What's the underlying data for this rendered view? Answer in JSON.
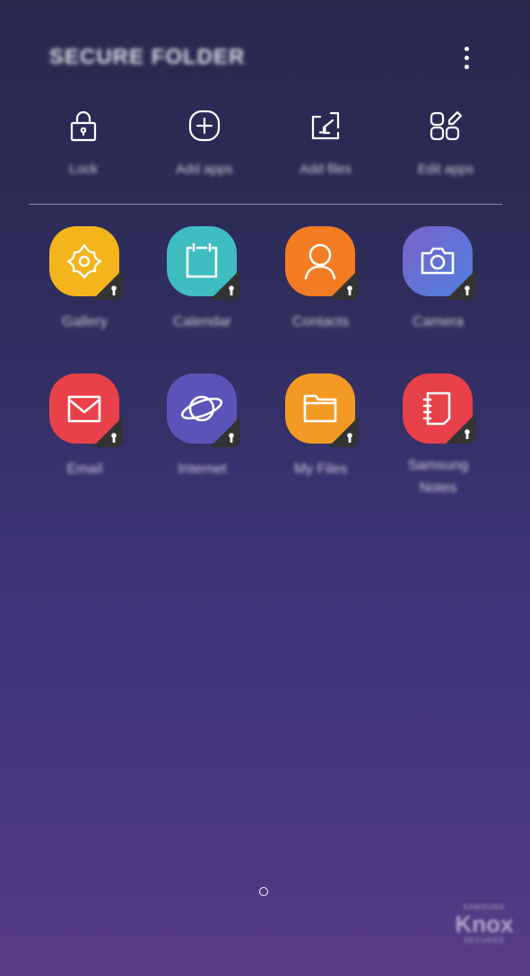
{
  "header": {
    "title": "SECURE FOLDER",
    "more_icon": "more-vertical-icon"
  },
  "actions": [
    {
      "label": "Lock",
      "icon": "lock-icon"
    },
    {
      "label": "Add apps",
      "icon": "add-circle-icon"
    },
    {
      "label": "Add files",
      "icon": "add-files-icon"
    },
    {
      "label": "Edit apps",
      "icon": "edit-apps-icon"
    }
  ],
  "apps": [
    {
      "label": "Gallery",
      "icon": "gallery-icon",
      "color": "#f3b41c"
    },
    {
      "label": "Calendar",
      "icon": "calendar-icon",
      "color": "#3fbdc0"
    },
    {
      "label": "Contacts",
      "icon": "contacts-icon",
      "color": "#f47c22"
    },
    {
      "label": "Camera",
      "icon": "camera-icon",
      "color": "#5f6fd6"
    },
    {
      "label": "Email",
      "icon": "email-icon",
      "color": "#e8414a"
    },
    {
      "label": "Internet",
      "icon": "internet-icon",
      "color": "#5b54b8"
    },
    {
      "label": "My Files",
      "icon": "folder-icon",
      "color": "#f39a25"
    },
    {
      "label": "Samsung Notes",
      "icon": "notes-icon",
      "color": "#e8414a"
    }
  ],
  "page_indicator": {
    "current": 1,
    "total": 1
  },
  "branding": {
    "top": "SAMSUNG",
    "main": "Knox",
    "bottom": "SECURED"
  }
}
